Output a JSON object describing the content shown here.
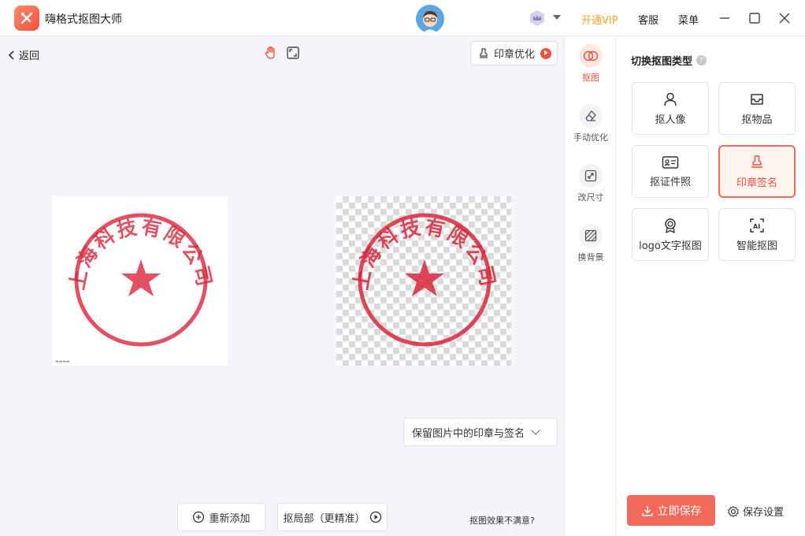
{
  "app": {
    "title": "嗨格式抠图大师"
  },
  "header": {
    "vip_label": "开通VIP",
    "service_label": "客服",
    "menu_label": "菜单"
  },
  "canvas": {
    "back_label": "返回",
    "optimize_label": "印章优化",
    "keep_option": "保留图片中的印章与签名",
    "re_add_label": "重新添加",
    "local_label": "抠局部（更精准）",
    "unsatisfied_label": "抠图效果不满意?",
    "stamp_text": "上海科技有限公司"
  },
  "tools": [
    {
      "label": "抠图",
      "icon": "cutout-icon",
      "active": true
    },
    {
      "label": "手动优化",
      "icon": "eraser-icon",
      "active": false
    },
    {
      "label": "改尺寸",
      "icon": "resize-icon",
      "active": false
    },
    {
      "label": "换背景",
      "icon": "background-icon",
      "active": false
    }
  ],
  "panel": {
    "title": "切换抠图类型",
    "help": "?",
    "types": [
      {
        "label": "抠人像",
        "icon": "person-icon",
        "active": false
      },
      {
        "label": "抠物品",
        "icon": "inbox-icon",
        "active": false
      },
      {
        "label": "抠证件照",
        "icon": "id-card-icon",
        "active": false
      },
      {
        "label": "印章签名",
        "icon": "stamp-icon",
        "active": true
      },
      {
        "label": "logo文字抠图",
        "icon": "badge-icon",
        "active": false
      },
      {
        "label": "智能抠图",
        "icon": "ai-icon",
        "active": false
      }
    ],
    "save_label": "立即保存",
    "save_settings_label": "保存设置"
  },
  "colors": {
    "accent": "#f0503c",
    "vip": "#f5a623",
    "stamp": "#d9263a"
  }
}
